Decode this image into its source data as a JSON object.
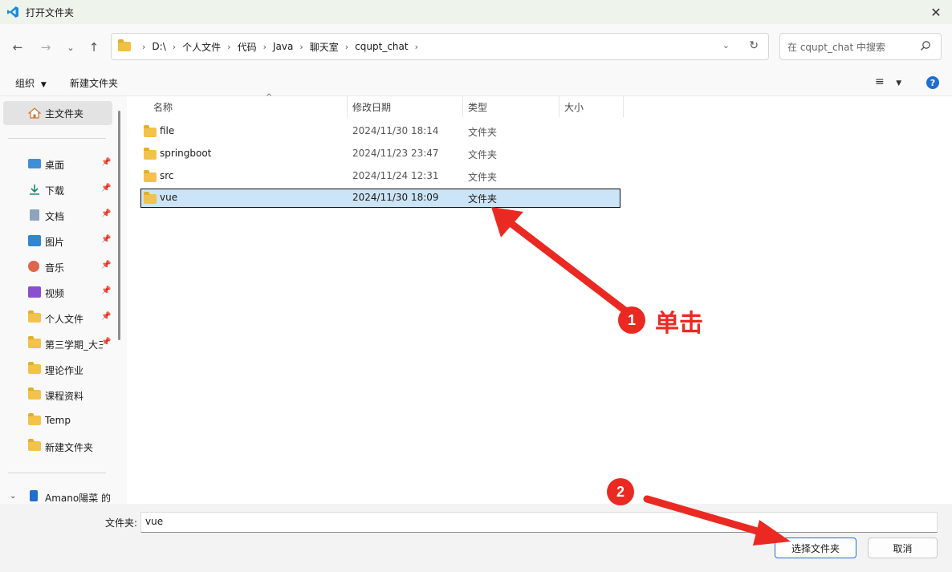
{
  "window": {
    "title": "打开文件夹"
  },
  "address": {
    "crumbs": [
      "D:\\",
      "个人文件",
      "代码",
      "Java",
      "聊天室",
      "cqupt_chat"
    ]
  },
  "search": {
    "placeholder": "在 cqupt_chat 中搜索"
  },
  "toolbar": {
    "organize": "组织",
    "new_folder": "新建文件夹"
  },
  "sidebar": {
    "home": "主文件夹",
    "quick": [
      {
        "label": "桌面",
        "icon": "desktop-icon",
        "pinned": true
      },
      {
        "label": "下载",
        "icon": "download-icon",
        "pinned": true
      },
      {
        "label": "文档",
        "icon": "document-icon",
        "pinned": true
      },
      {
        "label": "图片",
        "icon": "picture-icon",
        "pinned": true
      },
      {
        "label": "音乐",
        "icon": "music-icon",
        "pinned": true
      },
      {
        "label": "视频",
        "icon": "video-icon",
        "pinned": true
      },
      {
        "label": "个人文件",
        "icon": "folder-icon",
        "pinned": true
      },
      {
        "label": "第三学期_大三",
        "icon": "folder-icon",
        "pinned": true
      },
      {
        "label": "理论作业",
        "icon": "folder-icon",
        "pinned": false
      },
      {
        "label": "课程资料",
        "icon": "folder-icon",
        "pinned": false
      },
      {
        "label": "Temp",
        "icon": "folder-icon",
        "pinned": false
      },
      {
        "label": "新建文件夹",
        "icon": "folder-icon",
        "pinned": false
      }
    ],
    "pc": "Amano陽菜 的"
  },
  "columns": {
    "name": "名称",
    "date": "修改日期",
    "type": "类型",
    "size": "大小"
  },
  "files": [
    {
      "name": "file",
      "date": "2024/11/30 18:14",
      "type": "文件夹"
    },
    {
      "name": "springboot",
      "date": "2024/11/23 23:47",
      "type": "文件夹"
    },
    {
      "name": "src",
      "date": "2024/11/24 12:31",
      "type": "文件夹"
    },
    {
      "name": "vue",
      "date": "2024/11/30 18:09",
      "type": "文件夹"
    }
  ],
  "annotations": {
    "step1": "1",
    "step1_text": "单击",
    "step2": "2"
  },
  "bottom": {
    "label": "文件夹:",
    "value": "vue",
    "select": "选择文件夹",
    "cancel": "取消"
  },
  "colors": {
    "accent": "#1f6fcf",
    "selection": "#cce4f7",
    "annotation": "#ea2a22"
  }
}
